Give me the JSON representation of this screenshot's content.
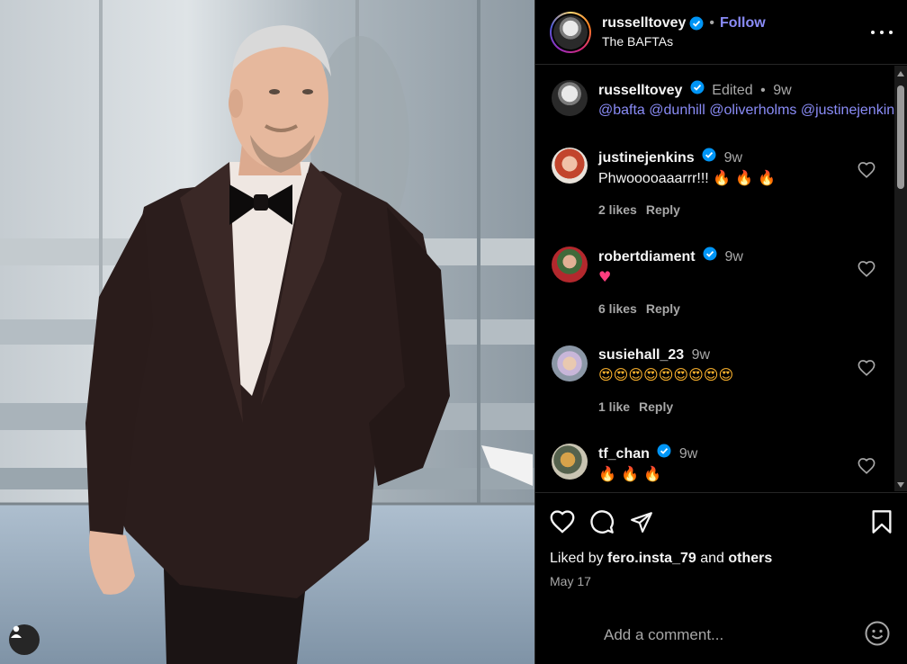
{
  "post": {
    "username": "russelltovey",
    "location": "The BAFTAs",
    "follow_label": "Follow",
    "caption_meta": "Edited",
    "caption_time": "9w",
    "caption_mentions": [
      "@bafta",
      "@dunhill",
      "@oliverholms",
      "@justinejenkins"
    ]
  },
  "comments": [
    {
      "username": "justinejenkins",
      "verified": true,
      "time": "9w",
      "text": "Phwooooaaarrr!!!",
      "emoji": "🔥 🔥 🔥",
      "likes": "2 likes",
      "reply": "Reply"
    },
    {
      "username": "robertdiament",
      "verified": true,
      "time": "9w",
      "text": "",
      "emoji": "♥",
      "likes": "6 likes",
      "reply": "Reply"
    },
    {
      "username": "susiehall_23",
      "verified": false,
      "time": "9w",
      "text": "",
      "emoji": "😍😍😍😍😍😍😍😍😍",
      "likes": "1 like",
      "reply": "Reply"
    },
    {
      "username": "tf_chan",
      "verified": true,
      "time": "9w",
      "text": "",
      "emoji": "🔥 🔥 🔥",
      "likes": "",
      "reply": ""
    }
  ],
  "footer": {
    "liked_prefix": "Liked by",
    "liked_user": "fero.insta_79",
    "liked_and": "and",
    "liked_others": "others",
    "date": "May 17",
    "comment_placeholder": "Add a comment..."
  },
  "colors": {
    "accent": "#8a8cf7",
    "verified": "#0095f6",
    "background": "#000000"
  },
  "icons": [
    "verified-badge-icon",
    "more-icon",
    "heart-icon",
    "comment-icon",
    "share-icon",
    "save-icon",
    "emoji-icon",
    "user-tag-icon"
  ]
}
